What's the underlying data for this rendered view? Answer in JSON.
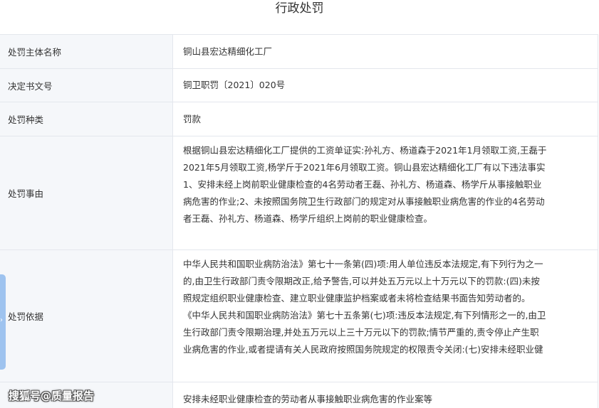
{
  "title": "行政处罚",
  "rows": [
    {
      "label": "处罚主体名称",
      "value": "铜山县宏达精细化工厂"
    },
    {
      "label": "决定书文号",
      "value": "铜卫职罚〔2021〕020号"
    },
    {
      "label": "处罚种类",
      "value": "罚款"
    },
    {
      "label": "处罚事由",
      "value": "根据铜山县宏达精细化工厂提供的工资单证实:孙礼方、杨道森于2021年1月领取工资,王磊于\n2021年5月领取工资,杨学斤于2021年6月领取工资。铜山县宏达精细化工厂有以下违法事实\n1、安排未经上岗前职业健康检查的4名劳动者王磊、孙礼方、杨道森、杨学斤从事接触职业\n病危害的作业;2、未按照国务院卫生行政部门的规定对从事接触职业病危害的作业的4名劳动\n者王磊、孙礼方、杨道森、杨学斤组织上岗前的职业健康检查。"
    },
    {
      "label": "处罚依据",
      "value": "中华人民共和国职业病防治法》第七十一条第(四)项:用人单位违反本法规定,有下列行为之一\n的,由卫生行政部门责令限期改正,给予警告,可以并处五万元以上十万元以下的罚款:(四)未按\n照规定组织职业健康检查、建立职业健康监护档案或者未将检查结果书面告知劳动者的。\n《中华人民共和国职业病防治法》第七十五条第(七)项:违反本法规定,有下列情形之一的,由卫\n生行政部门责令限期治理,并处五万元以上三十万元以下的罚款;情节严重的,责令停止产生职\n业病危害的作业,或者提请有关人民政府按照国务院规定的权限责令关闭:(七)安排未经职业健"
    },
    {
      "label": "",
      "value": "安排未经职业健康检查的劳动者从事接触职业病危害的作业案等"
    }
  ],
  "side_tab": {
    "icon": "chevron-right-icon",
    "glyph": "›",
    "color": "#9ec3ef"
  },
  "watermark": "搜狐号@质量报告"
}
